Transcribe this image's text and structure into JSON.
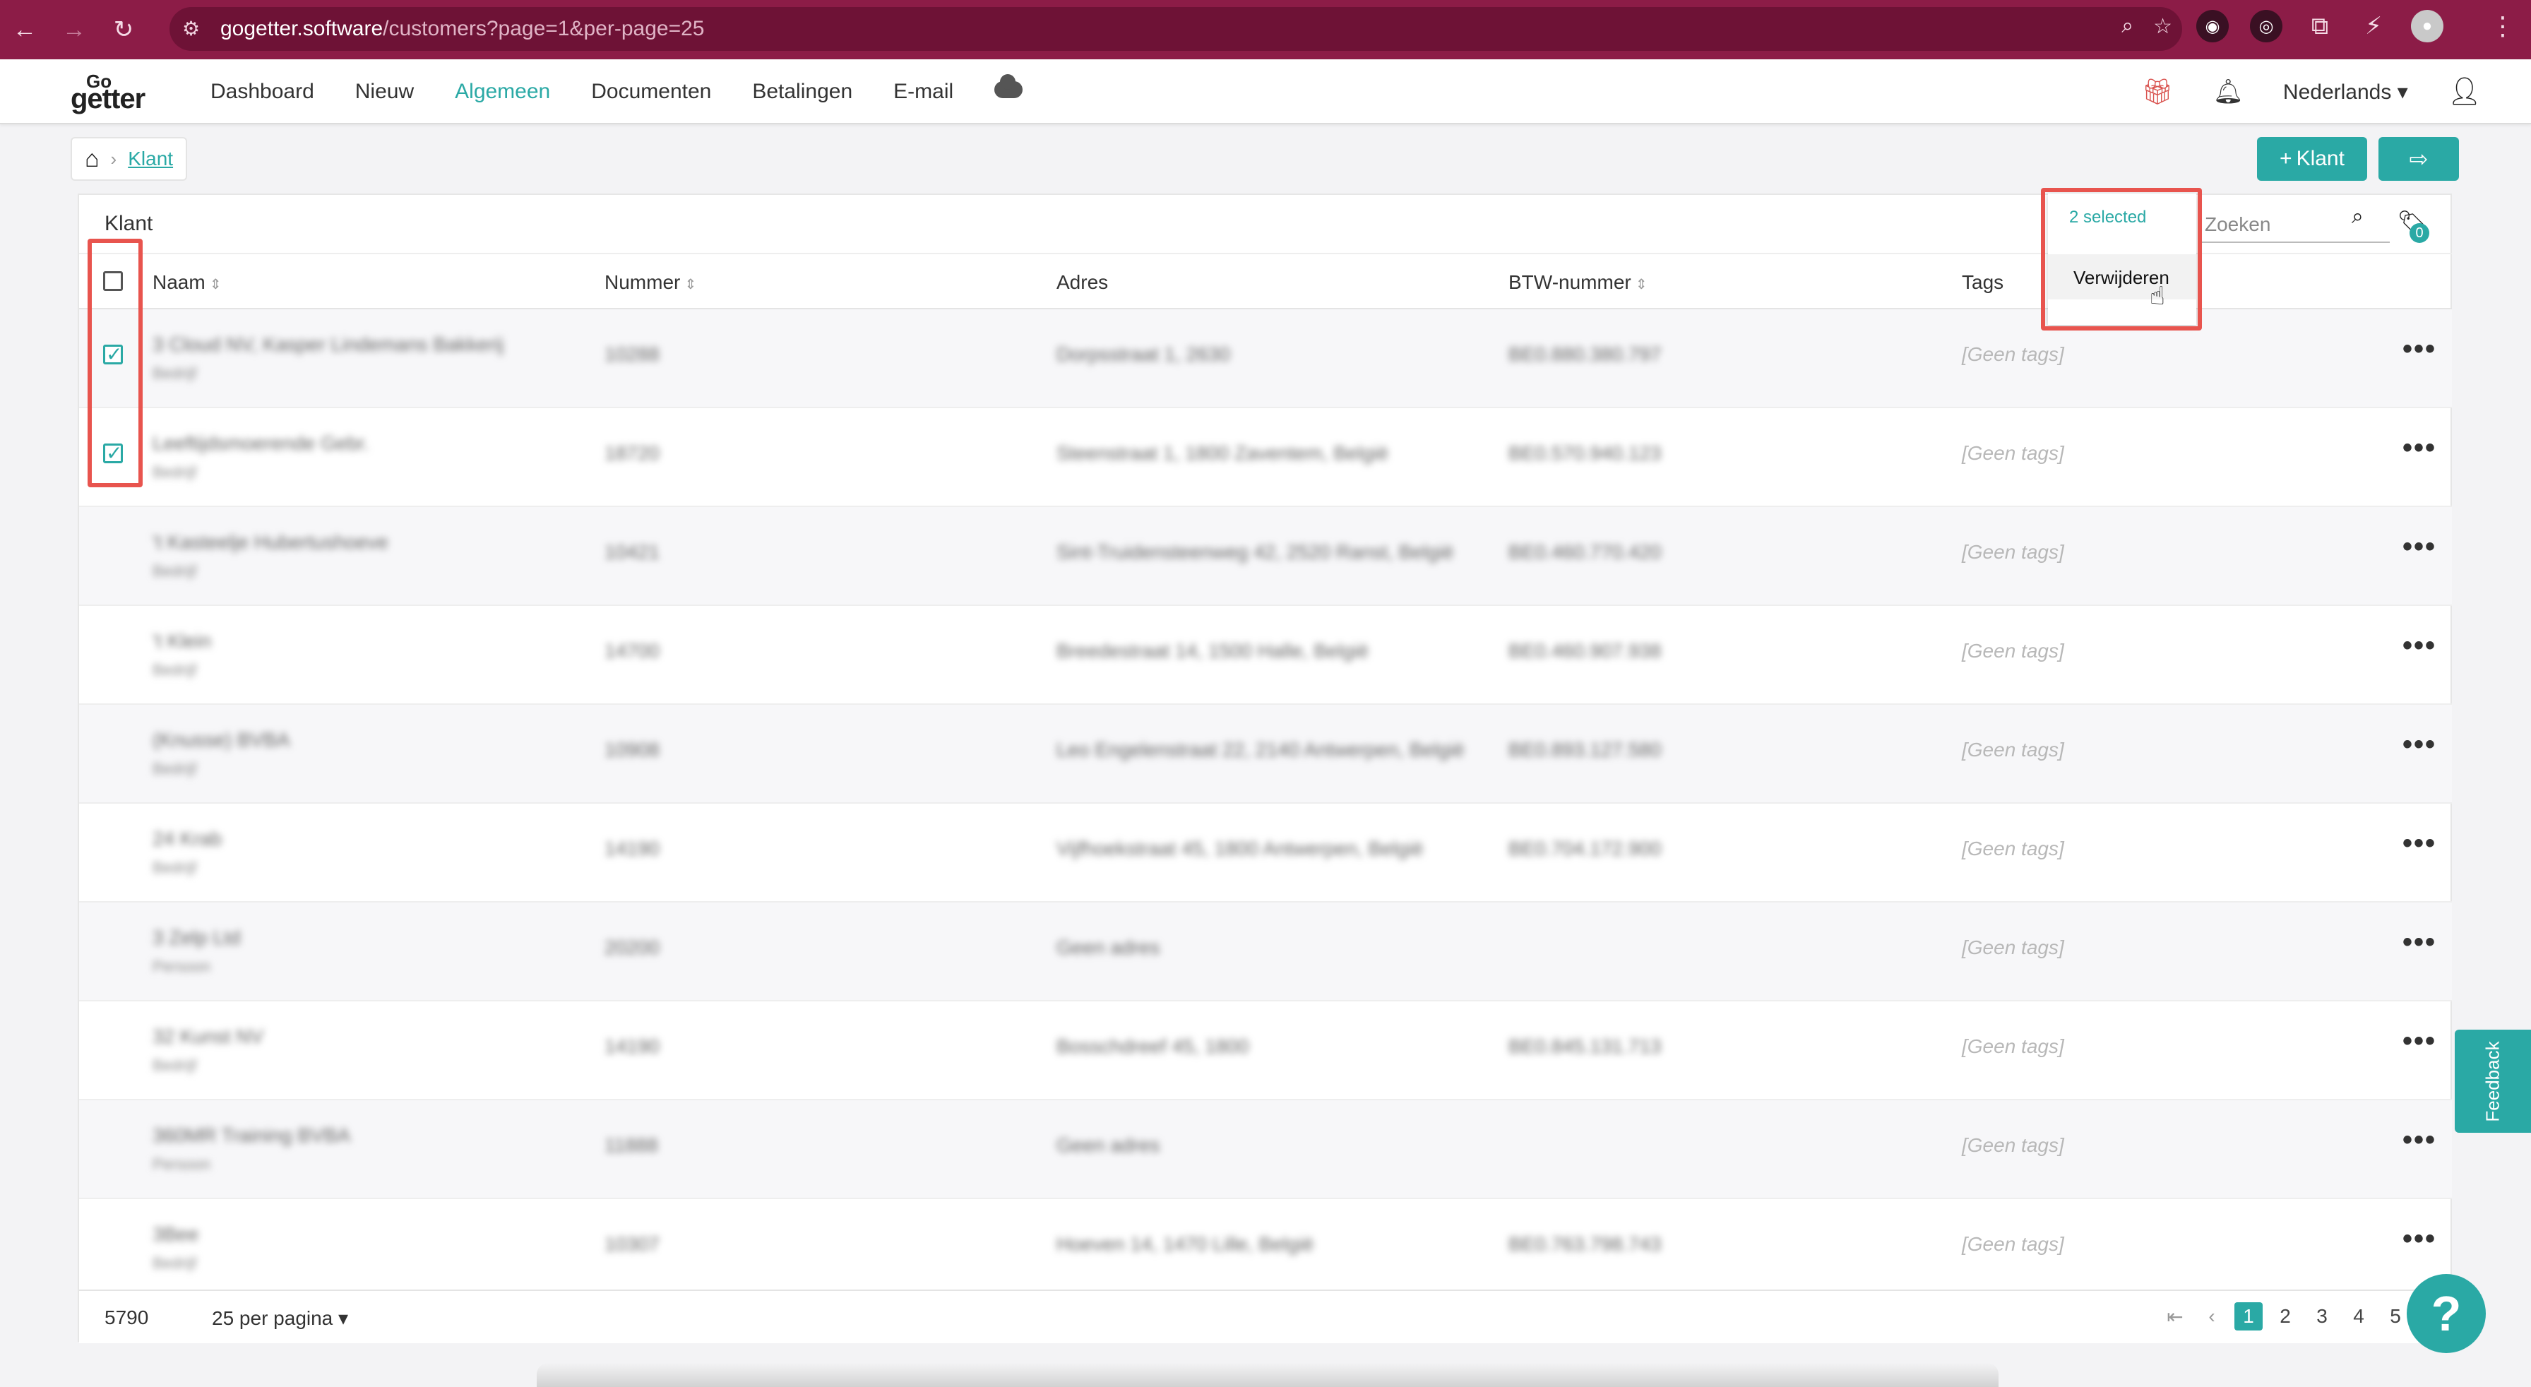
{
  "browser": {
    "url_host": "gogetter.software",
    "url_path": "/customers?page=1&per-page=25"
  },
  "app": {
    "logo_top": "Go",
    "logo_bottom": "getter",
    "menu": [
      "Dashboard",
      "Nieuw",
      "Algemeen",
      "Documenten",
      "Betalingen",
      "E-mail"
    ],
    "active_menu": "Algemeen",
    "language": "Nederlands"
  },
  "breadcrumb": {
    "current": "Klant"
  },
  "actions": {
    "add_label": "Klant"
  },
  "card": {
    "title": "Klant",
    "search_placeholder": "Zoeken",
    "tag_filter_count": "0"
  },
  "table": {
    "headers": {
      "name": "Naam",
      "number": "Nummer",
      "address": "Adres",
      "vat": "BTW-nummer",
      "tags": "Tags"
    },
    "rows": [
      {
        "name": "3 Cloud NV, Kasper Lindemans Bakkerij",
        "type": "Bedrijf",
        "number": "10288",
        "address": "Dorpsstraat 1, 2630",
        "vat": "BE0.880.380.797",
        "tags": "[Geen tags]",
        "checked": true
      },
      {
        "name": "Leeftijdsmoerende Gebr.",
        "type": "Bedrijf",
        "number": "18720",
        "address": "Steenstraat 1, 1800 Zaventem, België",
        "vat": "BE0.570.940.123",
        "tags": "[Geen tags]",
        "checked": true
      },
      {
        "name": "'t Kasteelje Hubertushoeve",
        "type": "Bedrijf",
        "number": "10421",
        "address": "Sint-Truidensteenweg 42, 2520 Ranst, België",
        "vat": "BE0.460.770.420",
        "tags": "[Geen tags]",
        "checked": false
      },
      {
        "name": "'t Klein",
        "type": "Bedrijf",
        "number": "14700",
        "address": "Breedestraat 14, 1500 Halle, België",
        "vat": "BE0.460.907.938",
        "tags": "[Geen tags]",
        "checked": false
      },
      {
        "name": "(Knusse) BVBA",
        "type": "Bedrijf",
        "number": "10908",
        "address": "Leo Engelenstraat 22, 2140 Antwerpen, België",
        "vat": "BE0.893.127.580",
        "tags": "[Geen tags]",
        "checked": false
      },
      {
        "name": "24 Krab",
        "type": "Bedrijf",
        "number": "14190",
        "address": "Vijfhoekstraat 45, 1800 Antwerpen, België",
        "vat": "BE0.704.172.900",
        "tags": "[Geen tags]",
        "checked": false
      },
      {
        "name": "3 Zelp Ltd",
        "type": "Persoon",
        "number": "20200",
        "address": "Geen adres",
        "vat": "",
        "tags": "[Geen tags]",
        "checked": false
      },
      {
        "name": "32 Kunst NV",
        "type": "Bedrijf",
        "number": "14190",
        "address": "Bosschdreef 45, 1800",
        "vat": "BE0.845.131.713",
        "tags": "[Geen tags]",
        "checked": false
      },
      {
        "name": "360MR Training BVBA",
        "type": "Persoon",
        "number": "11888",
        "address": "Geen adres",
        "vat": "",
        "tags": "[Geen tags]",
        "checked": false
      },
      {
        "name": "3Bee",
        "type": "Bedrijf",
        "number": "10307",
        "address": "Hoeven 14, 1470 Lille, België",
        "vat": "BE0.763.798.743",
        "tags": "[Geen tags]",
        "checked": false
      }
    ]
  },
  "footer": {
    "total": "5790",
    "per_page": "25 per pagina",
    "pages": [
      "1",
      "2",
      "3",
      "4",
      "5"
    ],
    "current_page": "1"
  },
  "bulk": {
    "selected_label": "2 selected",
    "delete_label": "Verwijderen"
  },
  "feedback_label": "Feedback",
  "help_label": "?"
}
